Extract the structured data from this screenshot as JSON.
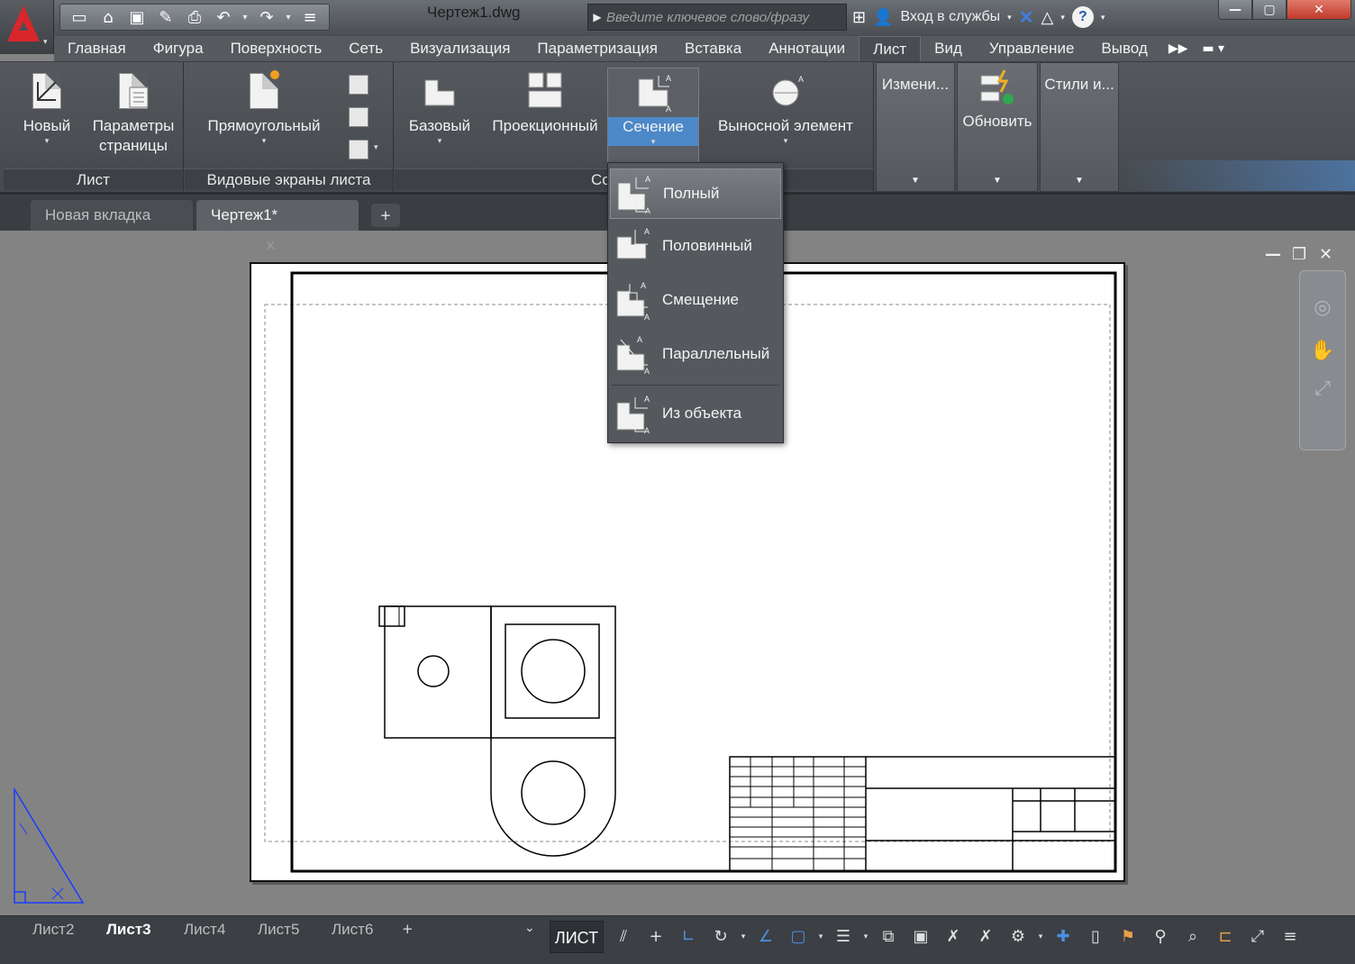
{
  "window": {
    "doc_title": "Чертеж1.dwg",
    "search_placeholder": "Введите ключевое слово/фразу",
    "signin_label": "Вход в службы",
    "help_label": "?"
  },
  "ribbon_tabs": [
    "Главная",
    "Фигура",
    "Поверхность",
    "Сеть",
    "Визуализация",
    "Параметризация",
    "Вставка",
    "Аннотации",
    "Лист",
    "Вид",
    "Управление",
    "Вывод"
  ],
  "active_tab": "Лист",
  "panels": {
    "layout": {
      "label": "Лист",
      "new_label": "Новый",
      "page_setup_label": "Параметры страницы"
    },
    "viewports": {
      "label": "Видовые экраны листа",
      "rect_label": "Прямоугольный"
    },
    "create_view": {
      "label": "Создание вида",
      "label_visible": "Со",
      "base_label": "Базовый",
      "projected_label": "Проекционный",
      "section_label": "Сечение",
      "detail_label": "Выносной элемент"
    },
    "modify": {
      "label": "Измени..."
    },
    "update": {
      "label": "Обновить"
    },
    "styles": {
      "label": "Стили и..."
    }
  },
  "section_menu": {
    "items": [
      "Полный",
      "Половинный",
      "Смещение",
      "Параллельный",
      "Из объекта"
    ],
    "hovered_index": 0
  },
  "doc_tabs": {
    "new_tab": "Новая вкладка",
    "current": "Чертеж1*"
  },
  "layout_tabs": [
    "Лист2",
    "Лист3",
    "Лист4",
    "Лист5",
    "Лист6"
  ],
  "active_layout": "Лист3",
  "status": {
    "mode": "ЛИСТ"
  },
  "colors": {
    "accent": "#4d88c8",
    "autocad_red": "#d9262b",
    "ucs_blue": "#1a3cff"
  },
  "icons": [
    "app-menu-icon",
    "new-file-icon",
    "open-icon",
    "save-icon",
    "save-as-icon",
    "print-icon",
    "undo-icon",
    "redo-icon",
    "binoculars-icon",
    "user-icon",
    "exchange-icon",
    "a360-icon",
    "help-icon"
  ]
}
